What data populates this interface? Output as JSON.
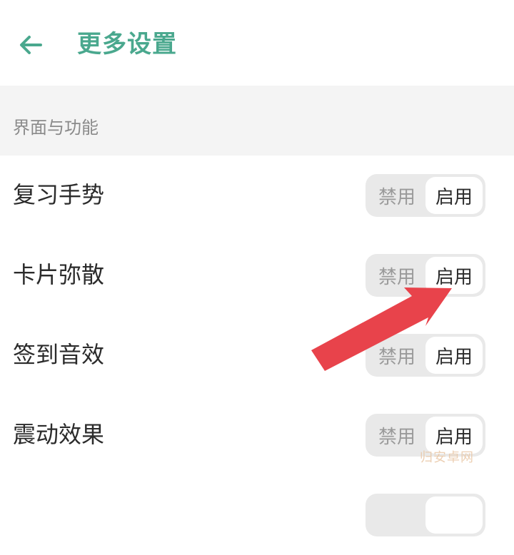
{
  "header": {
    "title": "更多设置",
    "back_icon": "arrow-left-icon"
  },
  "section": {
    "label": "界面与功能"
  },
  "rows": [
    {
      "label": "复习手势",
      "disable": "禁用",
      "enable": "启用",
      "state": "enabled"
    },
    {
      "label": "卡片弥散",
      "disable": "禁用",
      "enable": "启用",
      "state": "enabled"
    },
    {
      "label": "签到音效",
      "disable": "禁用",
      "enable": "启用",
      "state": "enabled"
    },
    {
      "label": "震动效果",
      "disable": "禁用",
      "enable": "启用",
      "state": "enabled"
    },
    {
      "label": "",
      "disable": "",
      "enable": "",
      "state": "enabled"
    }
  ],
  "colors": {
    "accent": "#4aa88e",
    "annotation_arrow": "#e8434b"
  },
  "watermark": "归安卓网"
}
